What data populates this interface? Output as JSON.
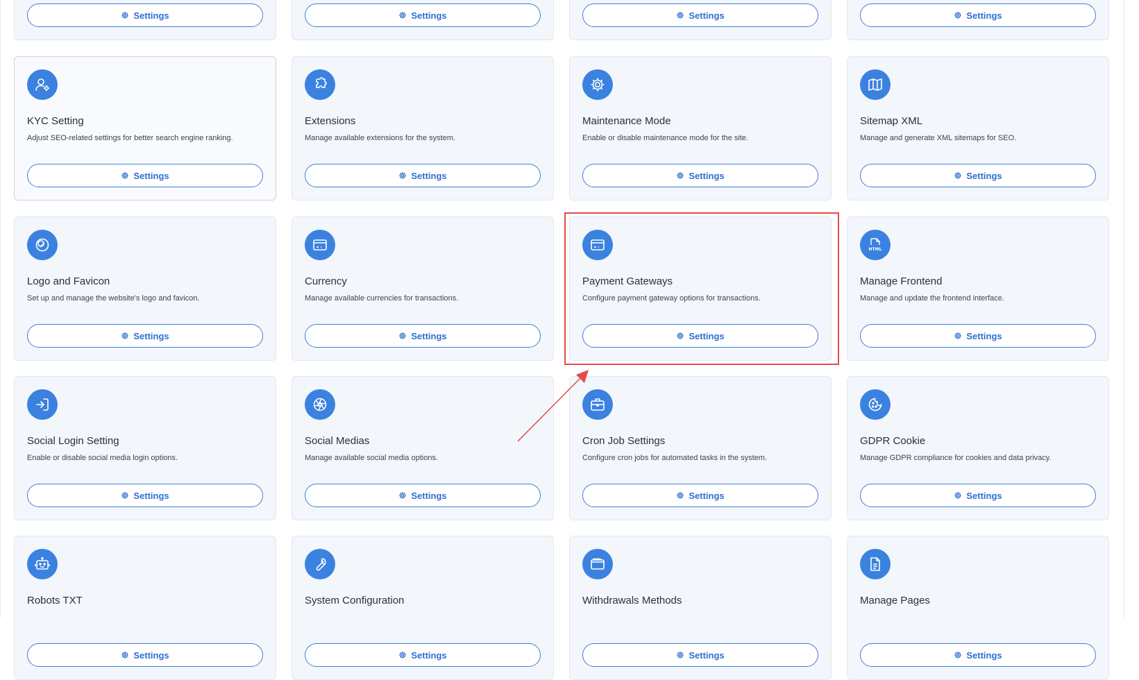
{
  "button_label": "Settings",
  "annotation": {
    "highlight_color": "#e54a4a",
    "arrow_color": "#e54a4a"
  },
  "accent_color": "#3b82e0",
  "cards": [
    {
      "id": "top-1",
      "title": "",
      "description": "",
      "icon": "none"
    },
    {
      "id": "top-2",
      "title": "",
      "description": "",
      "icon": "none"
    },
    {
      "id": "top-3",
      "title": "",
      "description": "",
      "icon": "none"
    },
    {
      "id": "top-4",
      "title": "",
      "description": "",
      "icon": "none"
    },
    {
      "id": "kyc",
      "title": "KYC Setting",
      "description": "Adjust SEO-related settings for better search engine ranking.",
      "icon": "user-settings-icon"
    },
    {
      "id": "extensions",
      "title": "Extensions",
      "description": "Manage available extensions for the system.",
      "icon": "puzzle-icon"
    },
    {
      "id": "maintenance",
      "title": "Maintenance Mode",
      "description": "Enable or disable maintenance mode for the site.",
      "icon": "gear-icon"
    },
    {
      "id": "sitemap",
      "title": "Sitemap XML",
      "description": "Manage and generate XML sitemaps for SEO.",
      "icon": "map-icon"
    },
    {
      "id": "logo",
      "title": "Logo and Favicon",
      "description": "Set up and manage the website's logo and favicon.",
      "icon": "logo-icon"
    },
    {
      "id": "currency",
      "title": "Currency",
      "description": "Manage available currencies for transactions.",
      "icon": "credit-card-icon"
    },
    {
      "id": "payment",
      "title": "Payment Gateways",
      "description": "Configure payment gateway options for transactions.",
      "icon": "credit-card-icon"
    },
    {
      "id": "frontend",
      "title": "Manage Frontend",
      "description": "Manage and update the frontend interface.",
      "icon": "html-file-icon"
    },
    {
      "id": "social-login",
      "title": "Social Login Setting",
      "description": "Enable or disable social media login options.",
      "icon": "login-icon"
    },
    {
      "id": "social-medias",
      "title": "Social Medias",
      "description": "Manage available social media options.",
      "icon": "aperture-icon"
    },
    {
      "id": "cron",
      "title": "Cron Job Settings",
      "description": "Configure cron jobs for automated tasks in the system.",
      "icon": "briefcase-icon"
    },
    {
      "id": "gdpr",
      "title": "GDPR Cookie",
      "description": "Manage GDPR compliance for cookies and data privacy.",
      "icon": "cookie-icon"
    },
    {
      "id": "robots",
      "title": "Robots TXT",
      "description": "",
      "icon": "robot-icon"
    },
    {
      "id": "system",
      "title": "System Configuration",
      "description": "",
      "icon": "wrench-icon"
    },
    {
      "id": "withdrawals",
      "title": "Withdrawals Methods",
      "description": "",
      "icon": "wallet-icon"
    },
    {
      "id": "pages",
      "title": "Manage Pages",
      "description": "",
      "icon": "document-icon"
    }
  ]
}
